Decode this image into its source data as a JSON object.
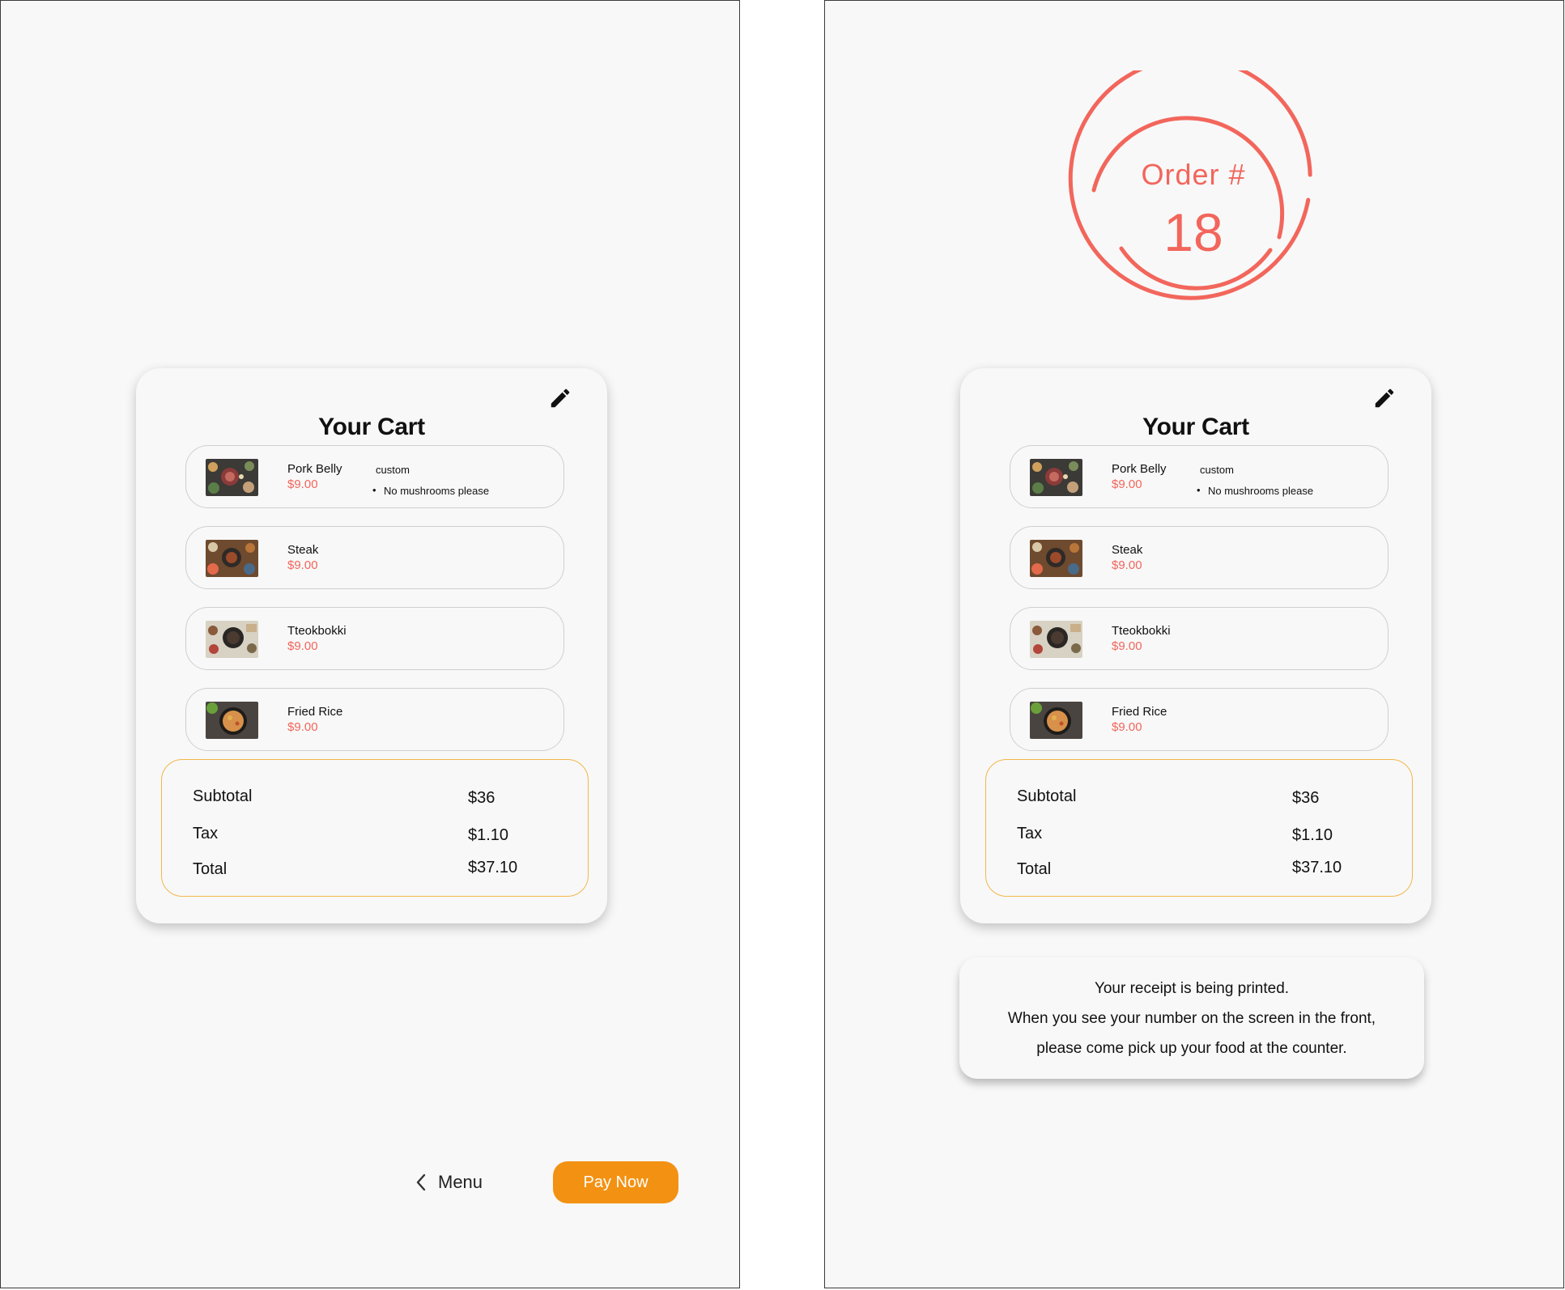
{
  "left_screen": {
    "cart": {
      "title": "Your Cart",
      "items": [
        {
          "name": "Pork Belly",
          "price": "$9.00",
          "custom_label": "custom",
          "custom_note": "No mushrooms please"
        },
        {
          "name": "Steak",
          "price": "$9.00"
        },
        {
          "name": "Tteokbokki",
          "price": "$9.00"
        },
        {
          "name": "Fried Rice",
          "price": "$9.00"
        }
      ],
      "totals": {
        "subtotal_label": "Subtotal",
        "subtotal_value": "$36",
        "tax_label": "Tax",
        "tax_value": "$1.10",
        "total_label": "Total",
        "total_value": "$37.10"
      }
    },
    "nav": {
      "menu_label": "Menu",
      "pay_label": "Pay Now"
    }
  },
  "right_screen": {
    "order": {
      "label": "Order #",
      "number": "18"
    },
    "cart": {
      "title": "Your Cart",
      "items": [
        {
          "name": "Pork Belly",
          "price": "$9.00",
          "custom_label": "custom",
          "custom_note": "No mushrooms please"
        },
        {
          "name": "Steak",
          "price": "$9.00"
        },
        {
          "name": "Tteokbokki",
          "price": "$9.00"
        },
        {
          "name": "Fried Rice",
          "price": "$9.00"
        }
      ],
      "totals": {
        "subtotal_label": "Subtotal",
        "subtotal_value": "$36",
        "tax_label": "Tax",
        "tax_value": "$1.10",
        "total_label": "Total",
        "total_value": "$37.10"
      }
    },
    "receipt": {
      "line1": "Your receipt is being printed.",
      "line2": "When you see your number on the screen in the front,",
      "line3": "please come pick up your food at the counter."
    }
  },
  "icons": {
    "edit": "pencil-icon",
    "back": "chevron-left-icon"
  },
  "colors": {
    "accent_orange": "#f39112",
    "price_red": "#f2665c",
    "order_red": "#f2665c",
    "totals_border": "#f2b74a"
  }
}
